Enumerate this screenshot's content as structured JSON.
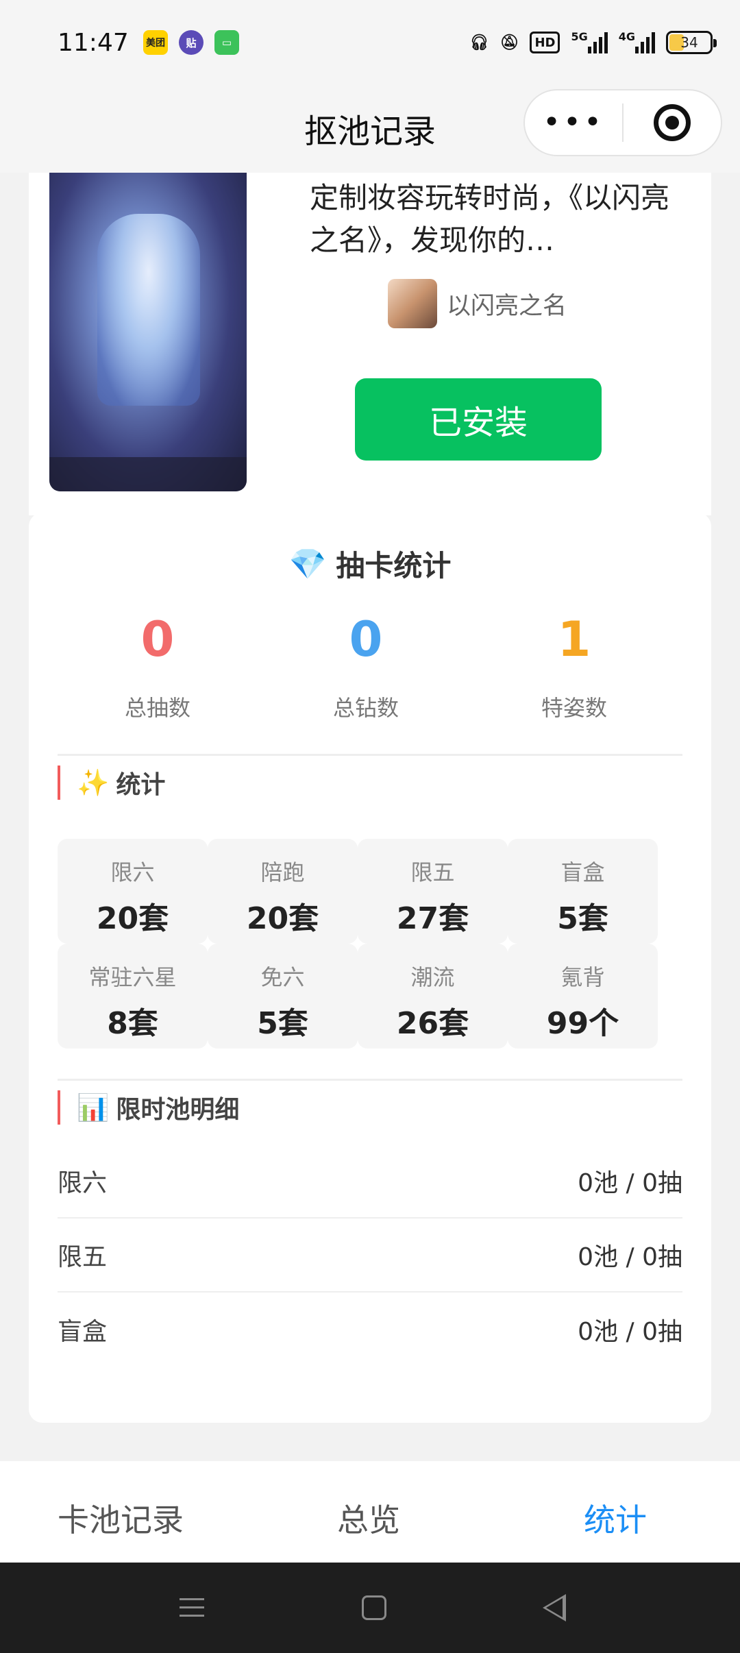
{
  "status": {
    "time": "11:47",
    "battery": "34",
    "hd": "HD",
    "net1": "5G",
    "net2": "4G",
    "app_icons": [
      "美团",
      "贴"
    ]
  },
  "nav": {
    "title": "抠池记录",
    "more": "•••"
  },
  "game": {
    "description": "定制妆容玩转时尚，《以闪亮之名》，发现你的…",
    "developer": "以闪亮之名",
    "install_label": "已安装"
  },
  "stats": {
    "title": "抽卡统计",
    "summary": [
      {
        "value": "0",
        "label": "总抽数",
        "color": "#f26b6b"
      },
      {
        "value": "0",
        "label": "总钻数",
        "color": "#4aa3ef"
      },
      {
        "value": "1",
        "label": "特姿数",
        "color": "#f5a623"
      }
    ],
    "section_stats": {
      "emoji": "✨",
      "title": "统计"
    },
    "grid": [
      {
        "name": "限六",
        "value": "20套"
      },
      {
        "name": "陪跑",
        "value": "20套"
      },
      {
        "name": "限五",
        "value": "27套"
      },
      {
        "name": "盲盒",
        "value": "5套"
      },
      {
        "name": "常驻六星",
        "value": "8套"
      },
      {
        "name": "免六",
        "value": "5套"
      },
      {
        "name": "潮流",
        "value": "26套"
      },
      {
        "name": "氪背",
        "value": "99个"
      }
    ],
    "section_detail": {
      "emoji": "📊",
      "title": "限时池明细"
    },
    "details": [
      {
        "name": "限六",
        "value": "0池 / 0抽"
      },
      {
        "name": "限五",
        "value": "0池 / 0抽"
      },
      {
        "name": "盲盒",
        "value": "0池 / 0抽"
      }
    ]
  },
  "tabs": [
    {
      "label": "卡池记录"
    },
    {
      "label": "总览"
    },
    {
      "label": "统计"
    }
  ],
  "colors": {
    "accent": "#1b8ef5",
    "install": "#07c160",
    "section_bar": "#f25b5b"
  }
}
